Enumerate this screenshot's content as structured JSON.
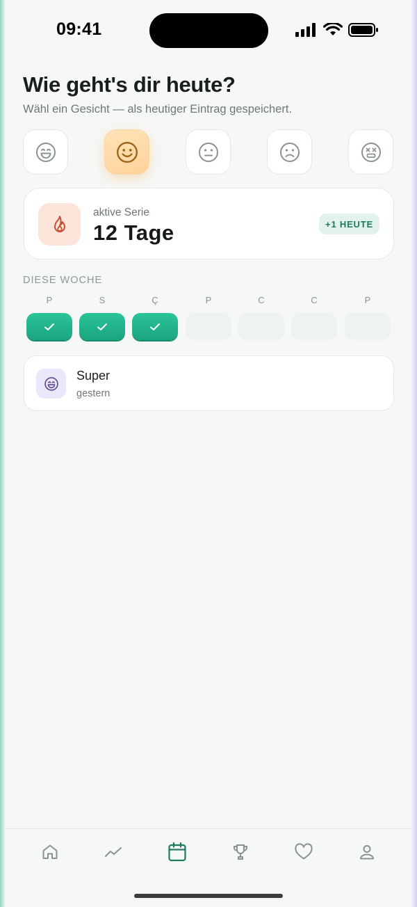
{
  "status_bar": {
    "time": "09:41",
    "icons": [
      "signal-icon",
      "wifi-icon",
      "battery-icon"
    ]
  },
  "header": {
    "title": "Wie geht's dir heute?",
    "subtitle": "Wähl ein Gesicht — als heutiger Eintrag gespeichert."
  },
  "moods": [
    {
      "icon": "grinning-face-icon",
      "selected": false
    },
    {
      "icon": "smiling-face-icon",
      "selected": true
    },
    {
      "icon": "neutral-face-icon",
      "selected": false
    },
    {
      "icon": "sad-face-icon",
      "selected": false
    },
    {
      "icon": "dizzy-face-icon",
      "selected": false
    }
  ],
  "streak": {
    "label": "aktive Serie",
    "value": "12 Tage",
    "badge": "+1 HEUTE",
    "icon": "flame-icon"
  },
  "week": {
    "label": "DIESE WOCHE",
    "days": [
      {
        "letter": "P",
        "done": true
      },
      {
        "letter": "S",
        "done": true
      },
      {
        "letter": "Ç",
        "done": true
      },
      {
        "letter": "P",
        "done": false
      },
      {
        "letter": "C",
        "done": false
      },
      {
        "letter": "C",
        "done": false
      },
      {
        "letter": "P",
        "done": false
      }
    ]
  },
  "entries": [
    {
      "title": "Super",
      "subtitle": "gestern",
      "icon": "grinning-face-icon"
    }
  ],
  "tabbar": {
    "items": [
      {
        "icon": "home-icon",
        "active": false
      },
      {
        "icon": "trend-icon",
        "active": false
      },
      {
        "icon": "calendar-icon",
        "active": true
      },
      {
        "icon": "trophy-icon",
        "active": false
      },
      {
        "icon": "heart-icon",
        "active": false
      },
      {
        "icon": "profile-icon",
        "active": false
      }
    ]
  },
  "colors": {
    "accent": "#1f9e78",
    "selected_mood": "#ffd9a3",
    "streak_icon_bg": "#fde4da",
    "entry_icon_bg": "#ece6fb"
  }
}
